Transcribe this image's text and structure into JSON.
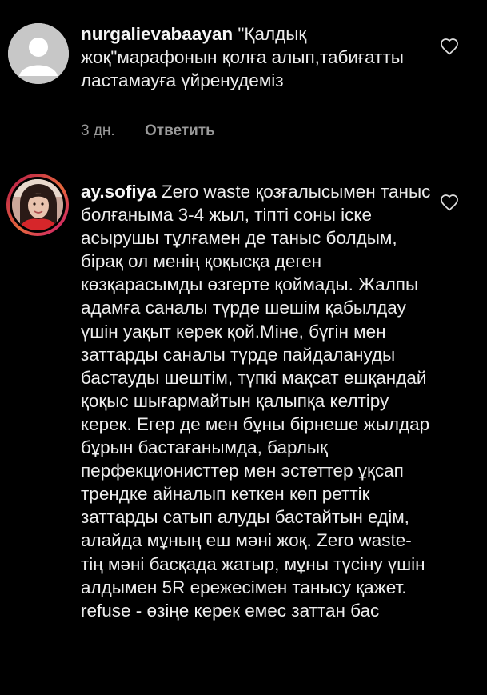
{
  "comments": [
    {
      "username": "nurgalievabaayan",
      "text": "\"Қалдық жоқ\"марафонын қолға алып,табиғатты ластамауға үйренудеміз",
      "time": "3 дн.",
      "reply_label": "Ответить",
      "avatar_icon": "default-profile-icon"
    },
    {
      "username": "ay.sofiya",
      "text": "Zero waste қозғалысымен таныс болғаныма 3-4 жыл, тіпті соны іске асырушы тұлғамен де таныс болдым, бірақ ол менің қоқысқа деген көзқарасымды өзгерте қоймады. Жалпы адамға саналы түрде шешім қабылдау үшін уақыт керек қой.Міне, бүгін мен заттарды саналы түрде пайдалануды бастауды шештім, түпкі мақсат ешқандай қоқыс шығармайтын қалыпқа келтіру керек. Егер де мен бұны бірнеше жылдар бұрын бастағанымда, барлық перфекционисттер мен эстеттер ұқсап трендке айналып кеткен көп реттік заттарды сатып алуды бастайтын едім, алайда мұның еш мәні жоқ. Zero waste-тің мәні басқада жатыр, мұны түсіну үшін алдымен 5R ережесімен танысу қажет.",
      "cutoff_line": "refuse - өзіңе керек емес заттан бас",
      "avatar_icon": "profile-photo-story-ring"
    }
  ],
  "colors": {
    "background": "#000000",
    "text": "#ededed",
    "muted": "#9a9a9a",
    "story_ring": "#e6683c"
  },
  "icons": {
    "like": "heart-outline-icon"
  }
}
